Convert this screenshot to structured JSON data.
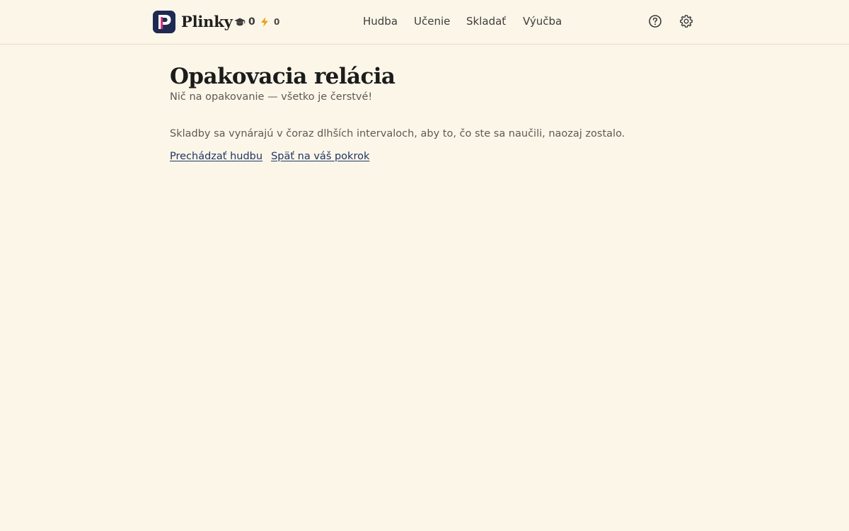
{
  "header": {
    "brand": {
      "logo_letter": "P",
      "name": "Plinky"
    },
    "stats": {
      "xp_icon": "graduation-cap-icon",
      "xp_value": "0",
      "streak_icon": "lightning-icon",
      "streak_value": "0"
    },
    "nav": {
      "items": [
        {
          "label": "Hudba"
        },
        {
          "label": "Učenie"
        },
        {
          "label": "Skladať"
        },
        {
          "label": "Výučba"
        }
      ]
    },
    "actions": {
      "help_icon": "help-circle-icon",
      "settings_icon": "gear-icon"
    }
  },
  "main": {
    "title": "Opakovacia relácia",
    "subtitle": "Nič na opakovanie — všetko je čerstvé!",
    "explanation": "Skladby sa vynárajú v čoraz dlhších intervaloch, aby to, čo ste sa naučili, naozaj zostalo.",
    "links": {
      "browse": "Prechádzať hudbu",
      "back": "Späť na váš pokrok"
    }
  },
  "colors": {
    "background": "#fcf6e9",
    "logo_bg": "#1e2a52",
    "logo_accent": "#d6297a",
    "link": "#1f3566",
    "header_border": "#e7dfcc"
  }
}
